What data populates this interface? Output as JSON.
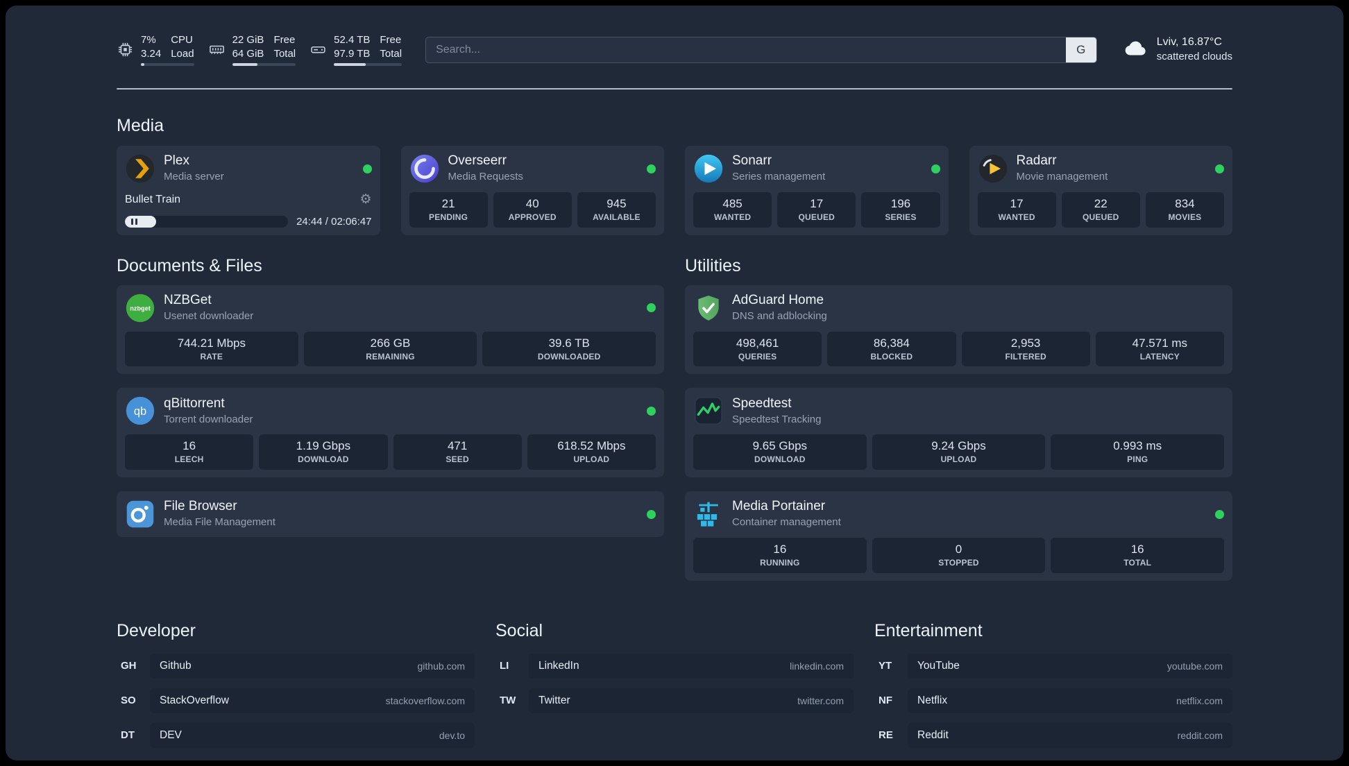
{
  "icons": {
    "gear": "⚙"
  },
  "topbar": {
    "monitors": [
      {
        "value_top": "7%",
        "value_bottom": "3.24",
        "label_top": "CPU",
        "label_bottom": "Load",
        "percent": 7
      },
      {
        "value_top": "22 GiB",
        "value_bottom": "64 GiB",
        "label_top": "Free",
        "label_bottom": "Total",
        "percent": 40
      },
      {
        "value_top": "52.4 TB",
        "value_bottom": "97.9 TB",
        "label_top": "Free",
        "label_bottom": "Total",
        "percent": 47
      }
    ],
    "search": {
      "placeholder": "Search...",
      "provider_label": "G"
    },
    "weather": {
      "location": "Lviv, 16.87°C",
      "condition": "scattered clouds"
    }
  },
  "sections": {
    "media": {
      "title": "Media",
      "cards": [
        {
          "name": "Plex",
          "subtitle": "Media server",
          "player": {
            "title": "Bullet Train",
            "time": "24:44 / 02:06:47",
            "progress_percent": 19
          }
        },
        {
          "name": "Overseerr",
          "subtitle": "Media Requests",
          "stats": [
            {
              "value": "21",
              "label": "PENDING"
            },
            {
              "value": "40",
              "label": "APPROVED"
            },
            {
              "value": "945",
              "label": "AVAILABLE"
            }
          ]
        },
        {
          "name": "Sonarr",
          "subtitle": "Series management",
          "stats": [
            {
              "value": "485",
              "label": "WANTED"
            },
            {
              "value": "17",
              "label": "QUEUED"
            },
            {
              "value": "196",
              "label": "SERIES"
            }
          ]
        },
        {
          "name": "Radarr",
          "subtitle": "Movie management",
          "stats": [
            {
              "value": "17",
              "label": "WANTED"
            },
            {
              "value": "22",
              "label": "QUEUED"
            },
            {
              "value": "834",
              "label": "MOVIES"
            }
          ]
        }
      ]
    },
    "documents": {
      "title": "Documents & Files",
      "cards": [
        {
          "name": "NZBGet",
          "subtitle": "Usenet downloader",
          "stats": [
            {
              "value": "744.21 Mbps",
              "label": "RATE"
            },
            {
              "value": "266 GB",
              "label": "REMAINING"
            },
            {
              "value": "39.6 TB",
              "label": "DOWNLOADED"
            }
          ]
        },
        {
          "name": "qBittorrent",
          "subtitle": "Torrent downloader",
          "stats": [
            {
              "value": "16",
              "label": "LEECH"
            },
            {
              "value": "1.19 Gbps",
              "label": "DOWNLOAD"
            },
            {
              "value": "471",
              "label": "SEED"
            },
            {
              "value": "618.52 Mbps",
              "label": "UPLOAD"
            }
          ]
        },
        {
          "name": "File Browser",
          "subtitle": "Media File Management"
        }
      ]
    },
    "utilities": {
      "title": "Utilities",
      "cards": [
        {
          "name": "AdGuard Home",
          "subtitle": "DNS and adblocking",
          "stats": [
            {
              "value": "498,461",
              "label": "QUERIES"
            },
            {
              "value": "86,384",
              "label": "BLOCKED"
            },
            {
              "value": "2,953",
              "label": "FILTERED"
            },
            {
              "value": "47.571 ms",
              "label": "LATENCY"
            }
          ]
        },
        {
          "name": "Speedtest",
          "subtitle": "Speedtest Tracking",
          "stats": [
            {
              "value": "9.65 Gbps",
              "label": "DOWNLOAD"
            },
            {
              "value": "9.24 Gbps",
              "label": "UPLOAD"
            },
            {
              "value": "0.993 ms",
              "label": "PING"
            }
          ]
        },
        {
          "name": "Media Portainer",
          "subtitle": "Container management",
          "stats": [
            {
              "value": "16",
              "label": "RUNNING"
            },
            {
              "value": "0",
              "label": "STOPPED"
            },
            {
              "value": "16",
              "label": "TOTAL"
            }
          ]
        }
      ]
    }
  },
  "bookmarks": [
    {
      "title": "Developer",
      "items": [
        {
          "abbr": "GH",
          "name": "Github",
          "url": "github.com"
        },
        {
          "abbr": "SO",
          "name": "StackOverflow",
          "url": "stackoverflow.com"
        },
        {
          "abbr": "DT",
          "name": "DEV",
          "url": "dev.to"
        }
      ]
    },
    {
      "title": "Social",
      "items": [
        {
          "abbr": "LI",
          "name": "LinkedIn",
          "url": "linkedin.com"
        },
        {
          "abbr": "TW",
          "name": "Twitter",
          "url": "twitter.com"
        }
      ]
    },
    {
      "title": "Entertainment",
      "items": [
        {
          "abbr": "YT",
          "name": "YouTube",
          "url": "youtube.com"
        },
        {
          "abbr": "NF",
          "name": "Netflix",
          "url": "netflix.com"
        },
        {
          "abbr": "RE",
          "name": "Reddit",
          "url": "reddit.com"
        }
      ]
    }
  ]
}
